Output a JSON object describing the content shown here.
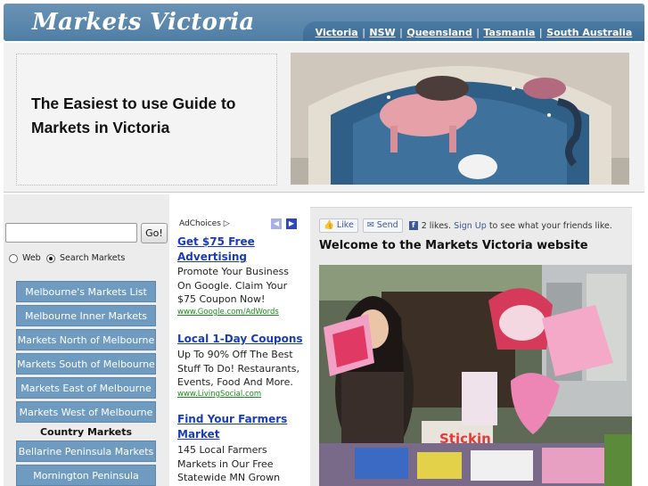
{
  "header": {
    "site_title": "Markets Victoria",
    "nav": [
      "Victoria",
      "NSW",
      "Queensland",
      "Tasmania",
      "South Australia"
    ]
  },
  "banner": {
    "tagline": "The Easiest to use Guide to Markets in Victoria"
  },
  "search": {
    "value": "",
    "go_label": "Go!",
    "options": [
      {
        "label": "Web",
        "selected": false
      },
      {
        "label": "Search Markets",
        "selected": true
      }
    ]
  },
  "menu": {
    "items": [
      "Melbourne's Markets List",
      "Melbourne Inner Markets",
      "Markets North of Melbourne",
      "Markets South of Melbourne",
      "Markets East of Melbourne",
      "Markets West of Melbourne"
    ],
    "heading": "Country Markets",
    "country_items": [
      "Bellarine Peninsula Markets",
      "Mornington Peninsula"
    ]
  },
  "ads": {
    "adchoices": "AdChoices",
    "items": [
      {
        "title": "Get $75 Free Advertising",
        "body": "Promote Your Business On Google. Claim Your $75 Coupon Now!",
        "url": "www.Google.com/AdWords"
      },
      {
        "title": "Local 1-Day Coupons",
        "body": "Up To 90% Off The Best Stuff To Do! Restaurants, Events, Food And More.",
        "url": "www.LivingSocial.com"
      },
      {
        "title": "Find Your Farmers Market",
        "body": "145 Local Farmers Markets in Our Free Statewide MN Grown",
        "url": ""
      }
    ]
  },
  "main": {
    "like_label": "Like",
    "send_label": "Send",
    "likes_text": "2 likes.",
    "signup_link": "Sign Up",
    "signup_suffix": "to see what your friends like.",
    "welcome": "Welcome to the Markets Victoria website"
  },
  "photo": {
    "stall_sign": "Stickin"
  },
  "colors": {
    "header_blue": "#5a88ae",
    "menu_blue": "#6f9bc0",
    "ad_link": "#1a3db5",
    "ad_url": "#1a8a1a"
  }
}
